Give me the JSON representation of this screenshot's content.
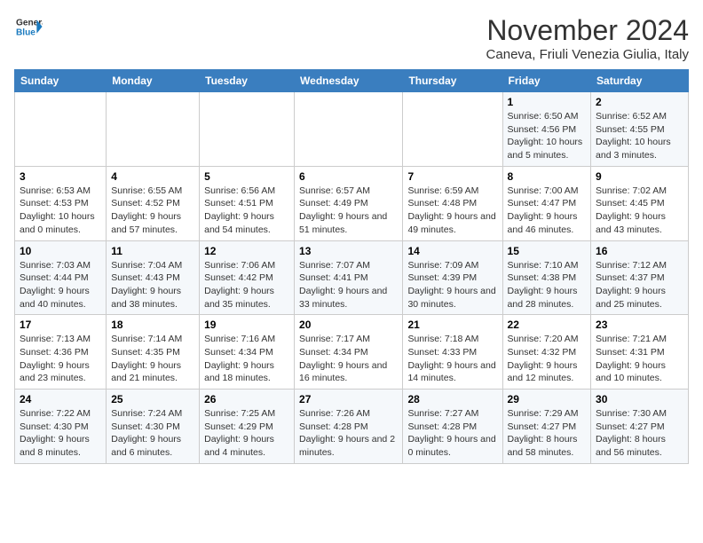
{
  "header": {
    "logo_line1": "General",
    "logo_line2": "Blue",
    "title": "November 2024",
    "subtitle": "Caneva, Friuli Venezia Giulia, Italy"
  },
  "weekdays": [
    "Sunday",
    "Monday",
    "Tuesday",
    "Wednesday",
    "Thursday",
    "Friday",
    "Saturday"
  ],
  "weeks": [
    [
      {
        "day": "",
        "info": ""
      },
      {
        "day": "",
        "info": ""
      },
      {
        "day": "",
        "info": ""
      },
      {
        "day": "",
        "info": ""
      },
      {
        "day": "",
        "info": ""
      },
      {
        "day": "1",
        "info": "Sunrise: 6:50 AM\nSunset: 4:56 PM\nDaylight: 10 hours\nand 5 minutes."
      },
      {
        "day": "2",
        "info": "Sunrise: 6:52 AM\nSunset: 4:55 PM\nDaylight: 10 hours\nand 3 minutes."
      }
    ],
    [
      {
        "day": "3",
        "info": "Sunrise: 6:53 AM\nSunset: 4:53 PM\nDaylight: 10 hours\nand 0 minutes."
      },
      {
        "day": "4",
        "info": "Sunrise: 6:55 AM\nSunset: 4:52 PM\nDaylight: 9 hours\nand 57 minutes."
      },
      {
        "day": "5",
        "info": "Sunrise: 6:56 AM\nSunset: 4:51 PM\nDaylight: 9 hours\nand 54 minutes."
      },
      {
        "day": "6",
        "info": "Sunrise: 6:57 AM\nSunset: 4:49 PM\nDaylight: 9 hours\nand 51 minutes."
      },
      {
        "day": "7",
        "info": "Sunrise: 6:59 AM\nSunset: 4:48 PM\nDaylight: 9 hours\nand 49 minutes."
      },
      {
        "day": "8",
        "info": "Sunrise: 7:00 AM\nSunset: 4:47 PM\nDaylight: 9 hours\nand 46 minutes."
      },
      {
        "day": "9",
        "info": "Sunrise: 7:02 AM\nSunset: 4:45 PM\nDaylight: 9 hours\nand 43 minutes."
      }
    ],
    [
      {
        "day": "10",
        "info": "Sunrise: 7:03 AM\nSunset: 4:44 PM\nDaylight: 9 hours\nand 40 minutes."
      },
      {
        "day": "11",
        "info": "Sunrise: 7:04 AM\nSunset: 4:43 PM\nDaylight: 9 hours\nand 38 minutes."
      },
      {
        "day": "12",
        "info": "Sunrise: 7:06 AM\nSunset: 4:42 PM\nDaylight: 9 hours\nand 35 minutes."
      },
      {
        "day": "13",
        "info": "Sunrise: 7:07 AM\nSunset: 4:41 PM\nDaylight: 9 hours\nand 33 minutes."
      },
      {
        "day": "14",
        "info": "Sunrise: 7:09 AM\nSunset: 4:39 PM\nDaylight: 9 hours\nand 30 minutes."
      },
      {
        "day": "15",
        "info": "Sunrise: 7:10 AM\nSunset: 4:38 PM\nDaylight: 9 hours\nand 28 minutes."
      },
      {
        "day": "16",
        "info": "Sunrise: 7:12 AM\nSunset: 4:37 PM\nDaylight: 9 hours\nand 25 minutes."
      }
    ],
    [
      {
        "day": "17",
        "info": "Sunrise: 7:13 AM\nSunset: 4:36 PM\nDaylight: 9 hours\nand 23 minutes."
      },
      {
        "day": "18",
        "info": "Sunrise: 7:14 AM\nSunset: 4:35 PM\nDaylight: 9 hours\nand 21 minutes."
      },
      {
        "day": "19",
        "info": "Sunrise: 7:16 AM\nSunset: 4:34 PM\nDaylight: 9 hours\nand 18 minutes."
      },
      {
        "day": "20",
        "info": "Sunrise: 7:17 AM\nSunset: 4:34 PM\nDaylight: 9 hours\nand 16 minutes."
      },
      {
        "day": "21",
        "info": "Sunrise: 7:18 AM\nSunset: 4:33 PM\nDaylight: 9 hours\nand 14 minutes."
      },
      {
        "day": "22",
        "info": "Sunrise: 7:20 AM\nSunset: 4:32 PM\nDaylight: 9 hours\nand 12 minutes."
      },
      {
        "day": "23",
        "info": "Sunrise: 7:21 AM\nSunset: 4:31 PM\nDaylight: 9 hours\nand 10 minutes."
      }
    ],
    [
      {
        "day": "24",
        "info": "Sunrise: 7:22 AM\nSunset: 4:30 PM\nDaylight: 9 hours\nand 8 minutes."
      },
      {
        "day": "25",
        "info": "Sunrise: 7:24 AM\nSunset: 4:30 PM\nDaylight: 9 hours\nand 6 minutes."
      },
      {
        "day": "26",
        "info": "Sunrise: 7:25 AM\nSunset: 4:29 PM\nDaylight: 9 hours\nand 4 minutes."
      },
      {
        "day": "27",
        "info": "Sunrise: 7:26 AM\nSunset: 4:28 PM\nDaylight: 9 hours\nand 2 minutes."
      },
      {
        "day": "28",
        "info": "Sunrise: 7:27 AM\nSunset: 4:28 PM\nDaylight: 9 hours\nand 0 minutes."
      },
      {
        "day": "29",
        "info": "Sunrise: 7:29 AM\nSunset: 4:27 PM\nDaylight: 8 hours\nand 58 minutes."
      },
      {
        "day": "30",
        "info": "Sunrise: 7:30 AM\nSunset: 4:27 PM\nDaylight: 8 hours\nand 56 minutes."
      }
    ]
  ]
}
